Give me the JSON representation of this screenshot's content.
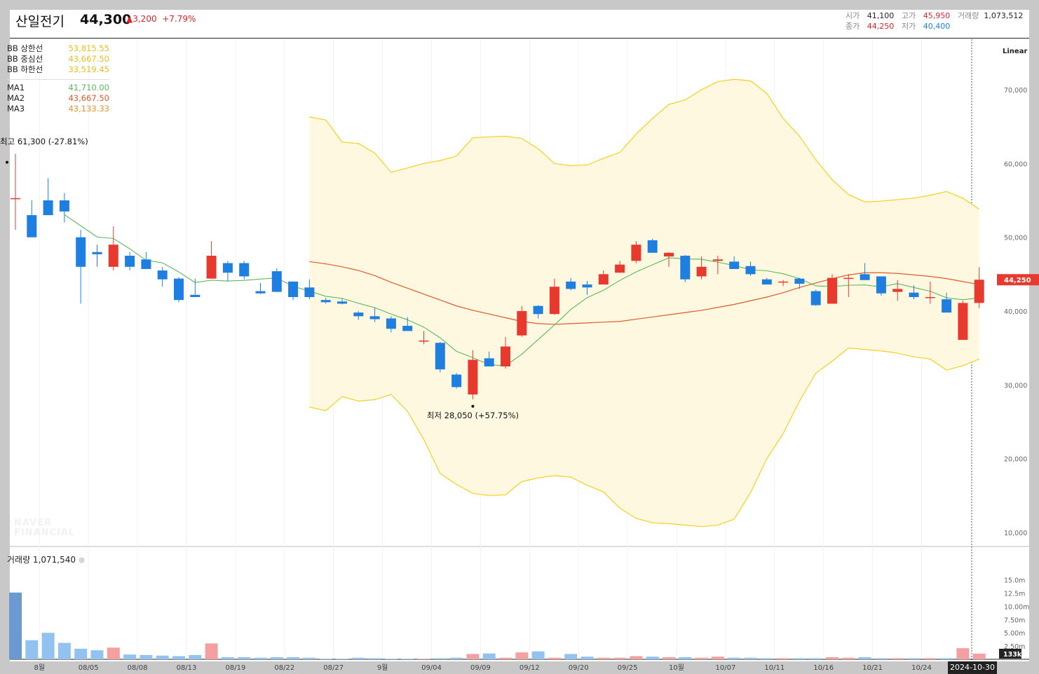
{
  "header": {
    "name": "산일전기",
    "price": "44,300",
    "change": "▲3,200",
    "change_pct": "+7.79%",
    "open_label": "시가",
    "open": "41,100",
    "high_label": "고가",
    "high": "45,950",
    "volume_label": "거래량",
    "volume": "1,073,512",
    "close_label": "종가",
    "close": "44,250",
    "low_label": "저가",
    "low": "40,400"
  },
  "legend": {
    "bb_upper_label": "BB 상한선",
    "bb_upper": "53,815.55",
    "bb_mid_label": "BB 중심선",
    "bb_mid": "43,667.50",
    "bb_lower_label": "BB 하한선",
    "bb_lower": "33,519.45",
    "ma1_label": "MA1",
    "ma1": "41,710.00",
    "ma2_label": "MA2",
    "ma2": "43,667.50",
    "ma3_label": "MA3",
    "ma3": "43,133.33"
  },
  "annotations": {
    "high": "최고 61,300 (-27.81%)",
    "low": "최저 28,050 (+57.75%)"
  },
  "scale_mode": "Linear",
  "volume_label": "거래량 1,071,540",
  "watermark": [
    "NAVER",
    "FINANCIAL"
  ],
  "last_price_badge": "44,250",
  "last_volume_badge": "133k",
  "date_badge": "2024-10-30",
  "colors": {
    "up": "#e8392f",
    "down": "#1e7fe0",
    "up_vol": "#f4a0a0",
    "down_vol": "#92c3f0",
    "bb_line": "#f5d020",
    "bb_fill": "#fff8e0",
    "ma1": "#5cb85c",
    "ma2": "#e05a2b",
    "ma3": "#e8962b"
  },
  "chart_data": {
    "type": "candlestick",
    "y_ticks": [
      "70,000",
      "60,000",
      "50,000",
      "40,000",
      "30,000",
      "20,000",
      "10,000"
    ],
    "ylim": [
      10000,
      70000
    ],
    "volume_ticks": [
      "15.0m",
      "12.5m",
      "10.00m",
      "7.50m",
      "5.00m",
      "2.50m"
    ],
    "x_ticks": [
      "8월",
      "08/05",
      "08/08",
      "08/13",
      "08/19",
      "08/22",
      "08/27",
      "9월",
      "09/04",
      "09/09",
      "09/12",
      "09/20",
      "09/25",
      "10월",
      "10/07",
      "10/11",
      "10/16",
      "10/21",
      "10/24",
      "2024-10-30"
    ],
    "candles": [
      {
        "o": 55300,
        "h": 61300,
        "l": 51000,
        "c": 55300
      },
      {
        "o": 53000,
        "h": 55000,
        "l": 50000,
        "c": 50000
      },
      {
        "o": 55000,
        "h": 58000,
        "l": 53000,
        "c": 53000
      },
      {
        "o": 55000,
        "h": 56000,
        "l": 52000,
        "c": 53500
      },
      {
        "o": 50000,
        "h": 51000,
        "l": 41000,
        "c": 46000
      },
      {
        "o": 48000,
        "h": 49000,
        "l": 46000,
        "c": 47700
      },
      {
        "o": 46000,
        "h": 51500,
        "l": 45500,
        "c": 49000
      },
      {
        "o": 47500,
        "h": 48000,
        "l": 45500,
        "c": 46000
      },
      {
        "o": 47000,
        "h": 48000,
        "l": 45800,
        "c": 45700
      },
      {
        "o": 45500,
        "h": 46000,
        "l": 43300,
        "c": 44300
      },
      {
        "o": 44400,
        "h": 44600,
        "l": 41200,
        "c": 41500
      },
      {
        "o": 42200,
        "h": 44400,
        "l": 42000,
        "c": 41900
      },
      {
        "o": 44400,
        "h": 49500,
        "l": 44400,
        "c": 47500
      },
      {
        "o": 46500,
        "h": 46800,
        "l": 44000,
        "c": 45200
      },
      {
        "o": 46500,
        "h": 46800,
        "l": 44300,
        "c": 44700
      },
      {
        "o": 42700,
        "h": 43800,
        "l": 42300,
        "c": 42400
      },
      {
        "o": 45400,
        "h": 45800,
        "l": 42600,
        "c": 42600
      },
      {
        "o": 44000,
        "h": 44000,
        "l": 41500,
        "c": 41900
      },
      {
        "o": 43200,
        "h": 44300,
        "l": 41600,
        "c": 41900
      },
      {
        "o": 41500,
        "h": 41800,
        "l": 41000,
        "c": 41200
      },
      {
        "o": 41300,
        "h": 41700,
        "l": 40900,
        "c": 41000
      },
      {
        "o": 39800,
        "h": 40000,
        "l": 38800,
        "c": 39300
      },
      {
        "o": 39300,
        "h": 40500,
        "l": 38500,
        "c": 38900
      },
      {
        "o": 39000,
        "h": 39300,
        "l": 37100,
        "c": 37600
      },
      {
        "o": 38000,
        "h": 39200,
        "l": 37300,
        "c": 37300
      },
      {
        "o": 36000,
        "h": 37300,
        "l": 35500,
        "c": 36000
      },
      {
        "o": 35700,
        "h": 35800,
        "l": 31700,
        "c": 32100
      },
      {
        "o": 31400,
        "h": 31600,
        "l": 29500,
        "c": 29700
      },
      {
        "o": 28700,
        "h": 34700,
        "l": 28050,
        "c": 33400
      },
      {
        "o": 33600,
        "h": 34500,
        "l": 32500,
        "c": 32500
      },
      {
        "o": 32500,
        "h": 36500,
        "l": 32200,
        "c": 35200
      },
      {
        "o": 36700,
        "h": 40700,
        "l": 36500,
        "c": 40000
      },
      {
        "o": 40700,
        "h": 40800,
        "l": 39000,
        "c": 39600
      },
      {
        "o": 39600,
        "h": 44400,
        "l": 39500,
        "c": 43300
      },
      {
        "o": 44000,
        "h": 44500,
        "l": 42800,
        "c": 43000
      },
      {
        "o": 43600,
        "h": 44100,
        "l": 42200,
        "c": 43200
      },
      {
        "o": 43600,
        "h": 45500,
        "l": 43600,
        "c": 45000
      },
      {
        "o": 45200,
        "h": 46800,
        "l": 45200,
        "c": 46300
      },
      {
        "o": 46800,
        "h": 49500,
        "l": 46500,
        "c": 49000
      },
      {
        "o": 49600,
        "h": 49800,
        "l": 47900,
        "c": 47900
      },
      {
        "o": 47400,
        "h": 48000,
        "l": 46000,
        "c": 47900
      },
      {
        "o": 47500,
        "h": 47600,
        "l": 43900,
        "c": 44300
      },
      {
        "o": 44700,
        "h": 47400,
        "l": 44300,
        "c": 46000
      },
      {
        "o": 46800,
        "h": 47500,
        "l": 45000,
        "c": 47000
      },
      {
        "o": 46700,
        "h": 47400,
        "l": 45800,
        "c": 45700
      },
      {
        "o": 46100,
        "h": 46700,
        "l": 44800,
        "c": 45000
      },
      {
        "o": 44300,
        "h": 44500,
        "l": 43600,
        "c": 43600
      },
      {
        "o": 43900,
        "h": 44200,
        "l": 43400,
        "c": 44000
      },
      {
        "o": 44400,
        "h": 44500,
        "l": 43000,
        "c": 43700
      },
      {
        "o": 42700,
        "h": 42900,
        "l": 40700,
        "c": 40800
      },
      {
        "o": 41000,
        "h": 45000,
        "l": 41000,
        "c": 44500
      },
      {
        "o": 44500,
        "h": 45000,
        "l": 41900,
        "c": 44500
      },
      {
        "o": 45000,
        "h": 46500,
        "l": 44300,
        "c": 44200
      },
      {
        "o": 44700,
        "h": 44700,
        "l": 42100,
        "c": 42400
      },
      {
        "o": 42600,
        "h": 44200,
        "l": 41400,
        "c": 43000
      },
      {
        "o": 42500,
        "h": 43500,
        "l": 41600,
        "c": 41900
      },
      {
        "o": 41800,
        "h": 44000,
        "l": 41000,
        "c": 41900
      },
      {
        "o": 41600,
        "h": 42500,
        "l": 40200,
        "c": 39800
      },
      {
        "o": 36100,
        "h": 41400,
        "l": 36100,
        "c": 41100
      },
      {
        "o": 41100,
        "h": 45950,
        "l": 40400,
        "c": 44250
      }
    ],
    "volume_m": [
      12.6,
      3.6,
      5.0,
      3.1,
      2.0,
      1.7,
      2.2,
      0.9,
      0.8,
      0.7,
      0.6,
      0.8,
      3.0,
      0.4,
      0.4,
      0.3,
      0.4,
      0.4,
      0.3,
      0.1,
      0.1,
      0.3,
      0.2,
      0.1,
      0.1,
      0.1,
      0.2,
      0.3,
      1.0,
      1.1,
      0.3,
      1.3,
      1.5,
      0.3,
      1.0,
      0.5,
      0.3,
      0.3,
      0.6,
      0.5,
      0.4,
      0.4,
      0.3,
      0.5,
      0.3,
      0.3,
      0.2,
      0.2,
      0.2,
      0.2,
      0.4,
      0.3,
      0.4,
      0.2,
      0.2,
      0.2,
      0.2,
      0.2,
      2.1,
      1.07
    ],
    "bb_upper": [
      null,
      null,
      null,
      null,
      null,
      null,
      null,
      null,
      null,
      null,
      null,
      null,
      null,
      null,
      null,
      null,
      null,
      null,
      66300,
      65900,
      62900,
      62700,
      61400,
      58800,
      59400,
      60000,
      60400,
      61000,
      63500,
      63600,
      63700,
      63400,
      62000,
      60000,
      59700,
      59800,
      60700,
      61500,
      64000,
      66100,
      68000,
      68600,
      70000,
      71100,
      71400,
      71200,
      69500,
      66100,
      63700,
      60500,
      57800,
      55800,
      54800,
      54900,
      55100,
      55300,
      55700,
      56200,
      55300,
      53800
    ],
    "bb_lower": [
      null,
      null,
      null,
      null,
      null,
      null,
      null,
      null,
      null,
      null,
      null,
      null,
      null,
      null,
      null,
      null,
      null,
      null,
      27000,
      26500,
      28400,
      27800,
      28000,
      28700,
      26400,
      22600,
      18000,
      16500,
      15300,
      15000,
      15100,
      16900,
      17400,
      17700,
      17500,
      16400,
      15500,
      13300,
      11900,
      11300,
      11200,
      11000,
      10800,
      11000,
      11800,
      15400,
      20000,
      23400,
      27800,
      31600,
      33200,
      35000,
      34800,
      34600,
      34300,
      33800,
      33500,
      32000,
      32600,
      33500
    ],
    "ma1": [
      null,
      null,
      null,
      null,
      null,
      null,
      null,
      null,
      null,
      null,
      null,
      null,
      null,
      null,
      null,
      null,
      null,
      null,
      null,
      null,
      null,
      null,
      null,
      null,
      null,
      null,
      null,
      null,
      null,
      null,
      null,
      null,
      null,
      null,
      null,
      null,
      null,
      null,
      null,
      null,
      null,
      null,
      null,
      null,
      null,
      null,
      null,
      null,
      null,
      null,
      null,
      null,
      null,
      null,
      null,
      null,
      null,
      null,
      null,
      null
    ],
    "ma2": [
      null,
      null,
      null,
      null,
      null,
      null,
      null,
      null,
      null,
      null,
      null,
      null,
      null,
      null,
      null,
      null,
      null,
      null,
      46700,
      46400,
      46000,
      45500,
      44800,
      43900,
      43100,
      42300,
      41500,
      40700,
      40100,
      39600,
      39100,
      38600,
      38300,
      38200,
      38300,
      38400,
      38500,
      38600,
      38900,
      39200,
      39500,
      39800,
      40100,
      40500,
      40900,
      41400,
      41900,
      42500,
      43200,
      43800,
      44400,
      44900,
      45200,
      45200,
      45100,
      44900,
      44700,
      44400,
      44000,
      43600
    ],
    "ma3": [
      null,
      null,
      null,
      null,
      null,
      null,
      null,
      null,
      null,
      null,
      null,
      null,
      null,
      null,
      null,
      null,
      null,
      null,
      null,
      null,
      null,
      null,
      null,
      null,
      null,
      null,
      null,
      null,
      null,
      null,
      null,
      null,
      null,
      null,
      null,
      null,
      null,
      null,
      null,
      null,
      null,
      null,
      null,
      null,
      null,
      null,
      null,
      null,
      null,
      null,
      null,
      null,
      null,
      null,
      null,
      null,
      null,
      null,
      null,
      null
    ]
  }
}
